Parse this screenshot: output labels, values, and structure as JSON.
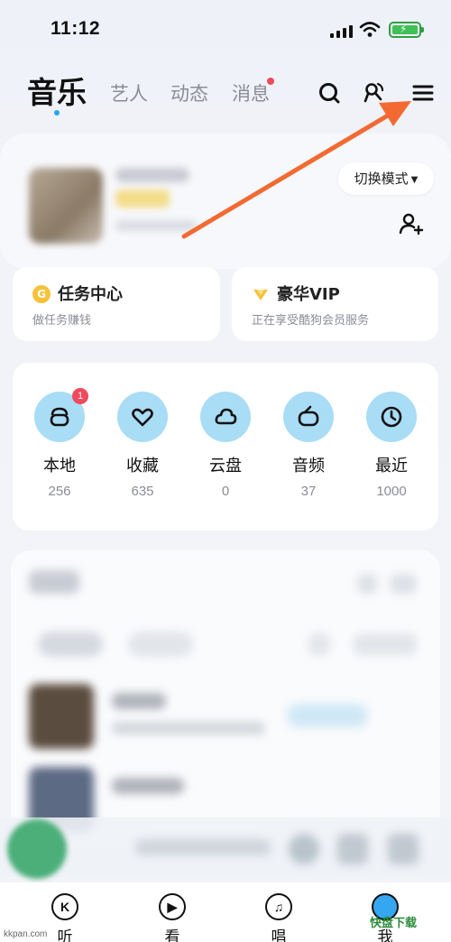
{
  "status_bar": {
    "time": "11:12"
  },
  "header": {
    "tabs": [
      {
        "label": "音乐",
        "active": true
      },
      {
        "label": "艺人",
        "active": false
      },
      {
        "label": "动态",
        "active": false
      },
      {
        "label": "消息",
        "active": false,
        "has_dot": true
      }
    ],
    "icons": [
      "search-icon",
      "voice-mic-icon",
      "menu-icon"
    ]
  },
  "profile": {
    "mode_switch_label": "切换模式",
    "add_user_icon": "add-user-icon"
  },
  "promos": {
    "task": {
      "icon_text": "G",
      "title": "任务中心",
      "subtitle": "做任务赚钱"
    },
    "vip": {
      "title": "豪华VIP",
      "subtitle": "正在享受酷狗会员服务"
    }
  },
  "quick_access": [
    {
      "label": "本地",
      "count": "256",
      "badge": "1",
      "icon": "local-music-icon"
    },
    {
      "label": "收藏",
      "count": "635",
      "icon": "favorite-heart-icon"
    },
    {
      "label": "云盘",
      "count": "0",
      "icon": "cloud-drive-icon"
    },
    {
      "label": "音频",
      "count": "37",
      "icon": "radio-audio-icon"
    },
    {
      "label": "最近",
      "count": "1000",
      "icon": "recent-clock-icon"
    }
  ],
  "bottom_nav": [
    {
      "label": "听",
      "icon_text": "K"
    },
    {
      "label": "看",
      "icon_text": "▶"
    },
    {
      "label": "唱",
      "icon_text": "♫"
    },
    {
      "label": "我",
      "icon_text": ""
    }
  ],
  "watermarks": {
    "left": "kkpan.com",
    "right": "快盘下载"
  },
  "colors": {
    "accent": "#22a6f2",
    "badge": "#f04a5d",
    "icon_bg": "#a9dcf5",
    "arrow": "#f26a32"
  }
}
